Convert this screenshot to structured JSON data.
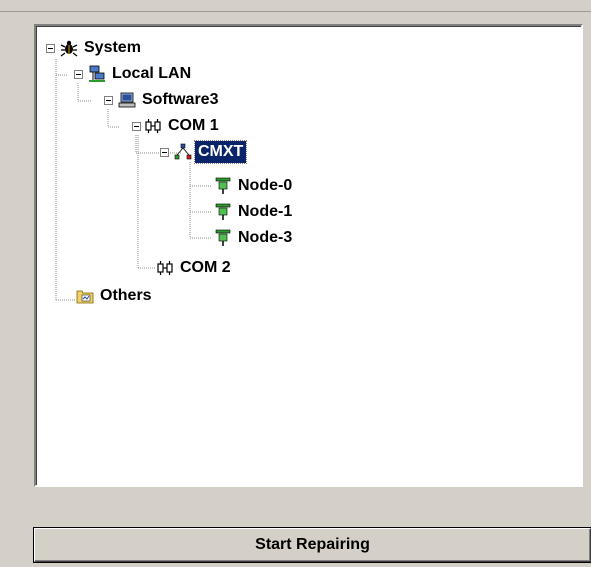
{
  "tree": {
    "root": "System",
    "lan": "Local LAN",
    "software": "Software3",
    "com1": "COM 1",
    "cmxt": "CMXT",
    "node0": "Node-0",
    "node1": "Node-1",
    "node3": "Node-3",
    "com2": "COM 2",
    "others": "Others",
    "selected": "CMXT"
  },
  "button": {
    "label": "Start Repairing"
  },
  "colors": {
    "selection": "#0a246a",
    "panel_bg": "#d4d0c8",
    "node_icon": "#2c9a2c"
  },
  "icons": {
    "system": "bug-icon",
    "lan": "network-icon",
    "software": "computer-icon",
    "com": "serial-port-icon",
    "cmxt": "network-tree-icon",
    "node": "green-device-icon",
    "others": "folder-icon"
  }
}
